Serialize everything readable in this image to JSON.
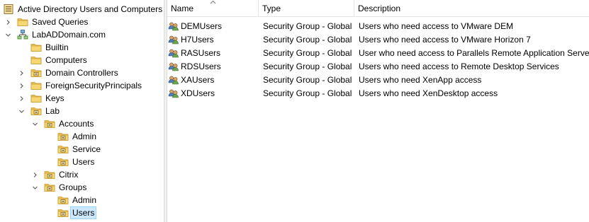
{
  "tree": {
    "root": {
      "label": "Active Directory Users and Computers",
      "icon": "aduc-icon"
    },
    "items": [
      {
        "id": "saved-queries",
        "label": "Saved Queries",
        "icon": "folder-icon",
        "expander": "collapsed"
      },
      {
        "id": "domain",
        "label": "LabADDomain.com",
        "icon": "domain-icon",
        "expander": "expanded"
      },
      {
        "id": "builtin",
        "label": "Builtin",
        "icon": "folder-icon",
        "expander": "none"
      },
      {
        "id": "computers",
        "label": "Computers",
        "icon": "folder-icon",
        "expander": "none"
      },
      {
        "id": "domain-controllers",
        "label": "Domain Controllers",
        "icon": "ou-icon",
        "expander": "collapsed"
      },
      {
        "id": "fsp",
        "label": "ForeignSecurityPrincipals",
        "icon": "folder-icon",
        "expander": "collapsed"
      },
      {
        "id": "keys",
        "label": "Keys",
        "icon": "folder-icon",
        "expander": "collapsed"
      },
      {
        "id": "lab",
        "label": "Lab",
        "icon": "ou-icon",
        "expander": "expanded"
      },
      {
        "id": "accounts",
        "label": "Accounts",
        "icon": "ou-icon",
        "expander": "expanded"
      },
      {
        "id": "accounts-admin",
        "label": "Admin",
        "icon": "ou-icon",
        "expander": "none"
      },
      {
        "id": "accounts-service",
        "label": "Service",
        "icon": "ou-icon",
        "expander": "none"
      },
      {
        "id": "accounts-users",
        "label": "Users",
        "icon": "ou-icon",
        "expander": "none"
      },
      {
        "id": "citrix",
        "label": "Citrix",
        "icon": "ou-icon",
        "expander": "collapsed"
      },
      {
        "id": "groups",
        "label": "Groups",
        "icon": "ou-icon",
        "expander": "expanded"
      },
      {
        "id": "groups-admin",
        "label": "Admin",
        "icon": "ou-icon",
        "expander": "none"
      },
      {
        "id": "groups-users",
        "label": "Users",
        "icon": "ou-icon",
        "expander": "none",
        "selected": true
      }
    ]
  },
  "list": {
    "columns": [
      {
        "label": "Name"
      },
      {
        "label": "Type"
      },
      {
        "label": "Description"
      }
    ],
    "rows": [
      {
        "name": "DEMUsers",
        "type": "Security Group - Global",
        "description": "Users who need access to VMware DEM",
        "icon": "group-icon"
      },
      {
        "name": "H7Users",
        "type": "Security Group - Global",
        "description": "Users who need access to VMware Horizon 7",
        "icon": "group-icon"
      },
      {
        "name": "RASUsers",
        "type": "Security Group - Global",
        "description": "User who need access to Parallels Remote Application Server",
        "icon": "group-icon"
      },
      {
        "name": "RDSUsers",
        "type": "Security Group - Global",
        "description": "Users who need access to Remote Desktop Services",
        "icon": "group-icon"
      },
      {
        "name": "XAUsers",
        "type": "Security Group - Global",
        "description": "Users who need XenApp access",
        "icon": "group-icon"
      },
      {
        "name": "XDUsers",
        "type": "Security Group - Global",
        "description": "Users who need XenDesktop access",
        "icon": "group-icon"
      }
    ]
  },
  "colors": {
    "selection_bg": "#cce8ff",
    "folder": "#e8c15a",
    "ou_badge": "#7a5a1e"
  }
}
